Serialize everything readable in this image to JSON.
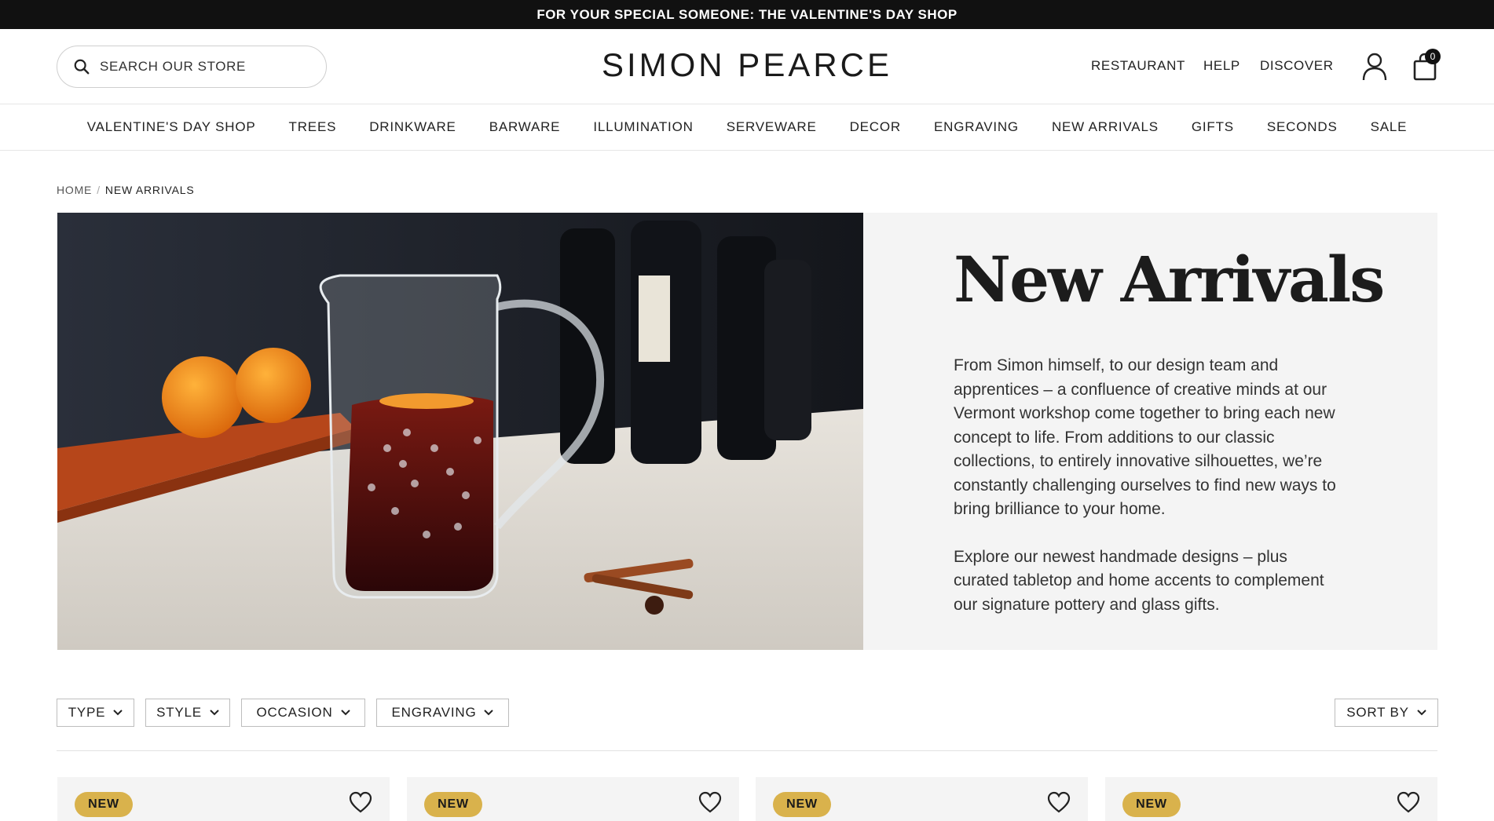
{
  "announcement": "FOR YOUR SPECIAL SOMEONE: THE VALENTINE'S DAY SHOP",
  "header": {
    "search_placeholder": "SEARCH OUR STORE",
    "logo": "SIMON PEARCE",
    "links": [
      "RESTAURANT",
      "HELP",
      "DISCOVER"
    ],
    "cart_count": "0"
  },
  "nav": [
    "VALENTINE'S DAY SHOP",
    "TREES",
    "DRINKWARE",
    "BARWARE",
    "ILLUMINATION",
    "SERVEWARE",
    "DECOR",
    "ENGRAVING",
    "NEW ARRIVALS",
    "GIFTS",
    "SECONDS",
    "SALE"
  ],
  "breadcrumb": {
    "home": "HOME",
    "separator": "/",
    "current": "NEW ARRIVALS"
  },
  "hero": {
    "title": "New Arrivals",
    "paragraph1": "From Simon himself, to our design team and apprentices – a confluence of creative minds at our Vermont workshop come together to bring each new concept to life. From additions to our classic collections, to entirely innovative silhouettes, we’re constantly challenging ourselves to find new ways to bring brilliance to your home.",
    "paragraph2": "Explore our newest handmade designs – plus curated tabletop and home accents to complement our signature pottery and glass gifts."
  },
  "filters": [
    "TYPE",
    "STYLE",
    "OCCASION",
    "ENGRAVING"
  ],
  "sort_label": "SORT BY",
  "products": [
    {
      "badge": "NEW"
    },
    {
      "badge": "NEW"
    },
    {
      "badge": "NEW"
    },
    {
      "badge": "NEW"
    }
  ],
  "colors": {
    "announcement_bg": "#111111",
    "badge": "#d9b24c",
    "panel_bg": "#f4f4f4"
  }
}
